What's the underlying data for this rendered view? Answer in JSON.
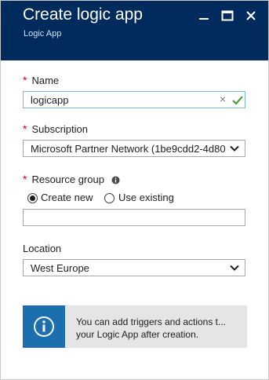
{
  "header": {
    "title": "Create logic app",
    "subtitle": "Logic App"
  },
  "form": {
    "name": {
      "required_mark": "*",
      "label": "Name",
      "value": "logicapp",
      "clear_glyph": "×"
    },
    "subscription": {
      "required_mark": "*",
      "label": "Subscription",
      "value": "Microsoft Partner Network (1be9cdd2-4d80"
    },
    "resource_group": {
      "required_mark": "*",
      "label": "Resource group",
      "options": [
        {
          "label": "Create new",
          "selected": true
        },
        {
          "label": "Use existing",
          "selected": false
        }
      ],
      "value": ""
    },
    "location": {
      "label": "Location",
      "value": "West Europe"
    }
  },
  "info": {
    "line1": "You can add triggers and actions t...",
    "line2": "your Logic App after creation."
  },
  "colors": {
    "header_bg": "#002b5c",
    "required": "#e0001b",
    "valid_check": "#3a9a2b",
    "info_icon_bg": "#1c6fae"
  },
  "icons": [
    "minimize-icon",
    "maximize-icon",
    "close-icon",
    "info-tooltip-icon",
    "checkmark-icon",
    "chevron-down-icon",
    "info-icon"
  ]
}
